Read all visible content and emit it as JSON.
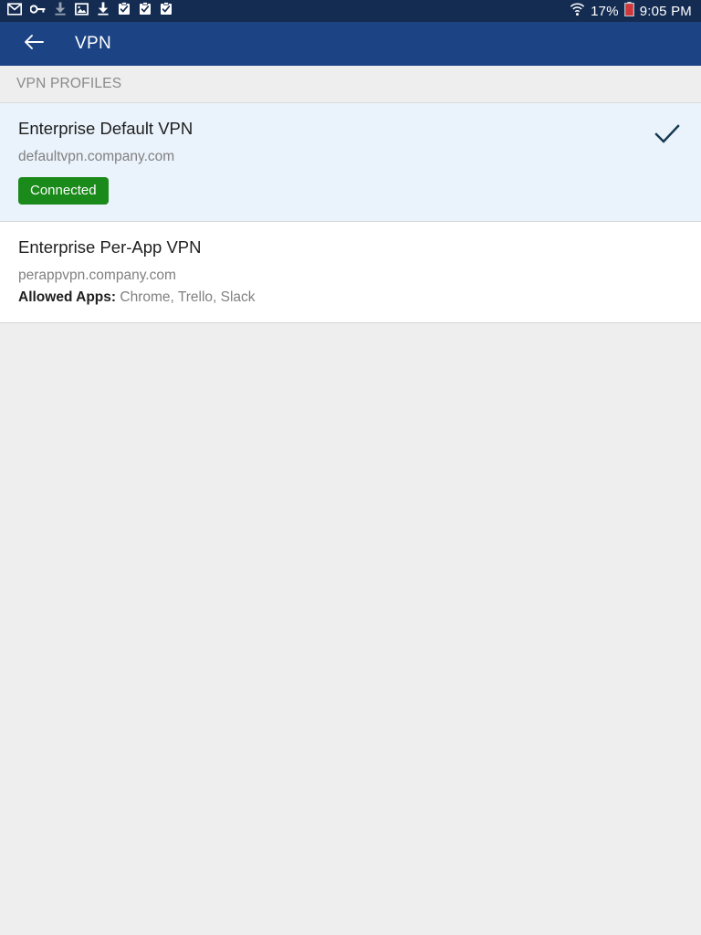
{
  "status_bar": {
    "background": "#152c52",
    "left_icons": [
      {
        "name": "mail-icon",
        "glyph": "envelope"
      },
      {
        "name": "key-icon",
        "glyph": "key"
      },
      {
        "name": "download-icon-dim",
        "glyph": "download"
      },
      {
        "name": "photo-icon",
        "glyph": "image"
      },
      {
        "name": "download-icon",
        "glyph": "download"
      },
      {
        "name": "clipboard-check-icon-1",
        "glyph": "clipboard-check"
      },
      {
        "name": "clipboard-check-icon-2",
        "glyph": "clipboard-check"
      },
      {
        "name": "clipboard-check-icon-3",
        "glyph": "clipboard-check"
      }
    ],
    "wifi_icon": "wifi-icon",
    "battery_percent": "17%",
    "battery_icon": "battery-low-icon",
    "battery_color": "#e03a3a",
    "clock": "9:05 PM"
  },
  "app_bar": {
    "background": "#1c4484",
    "back_icon": "back-arrow-icon",
    "title": "VPN"
  },
  "section": {
    "header": "VPN PROFILES"
  },
  "profiles": [
    {
      "title": "Enterprise Default VPN",
      "server": "defaultvpn.company.com",
      "status_badge": "Connected",
      "badge_color": "#1a8a1a",
      "selected": true,
      "check_icon": "checkmark-icon",
      "check_color": "#14384f"
    },
    {
      "title": "Enterprise Per-App VPN",
      "server": "perappvpn.company.com",
      "allowed_apps_label": "Allowed Apps:",
      "allowed_apps_value": "Chrome, Trello, Slack",
      "selected": false
    }
  ],
  "colors": {
    "page_background": "#eeeeee",
    "row_background": "#ffffff",
    "selected_row_background": "#eaf3fb",
    "divider": "#d6d6d6"
  }
}
